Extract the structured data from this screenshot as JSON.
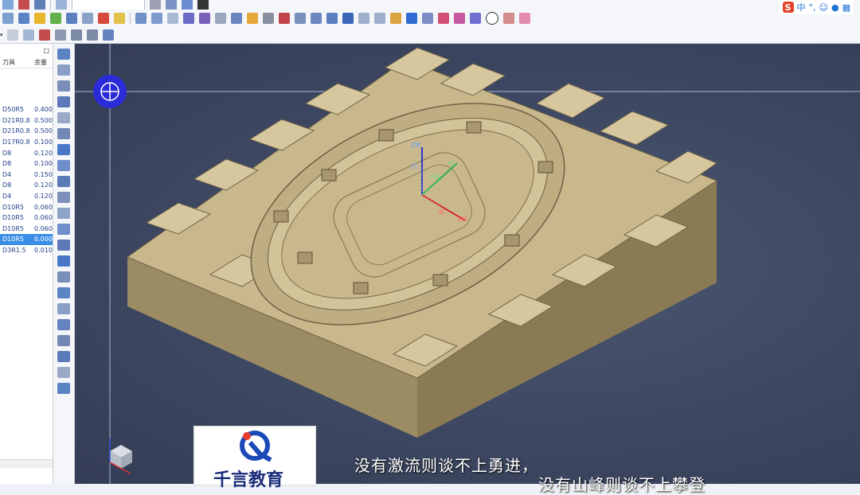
{
  "ime": {
    "logo": "S",
    "lang": "中",
    "punct": "°,"
  },
  "navigator": {
    "columns": [
      "刀具",
      "余量"
    ],
    "tools": [
      {
        "name": "D50R5",
        "allowance": "0.400"
      },
      {
        "name": "D21R0.8",
        "allowance": "0.500"
      },
      {
        "name": "D21R0.8",
        "allowance": "0.500"
      },
      {
        "name": "D17R0.8",
        "allowance": "0.100"
      },
      {
        "name": "D8",
        "allowance": "0.120"
      },
      {
        "name": "D8",
        "allowance": "0.100"
      },
      {
        "name": "D4",
        "allowance": "0.150"
      },
      {
        "name": "D8",
        "allowance": "0.120"
      },
      {
        "name": "D4",
        "allowance": "0.120"
      },
      {
        "name": "D10R5",
        "allowance": "0.060"
      },
      {
        "name": "D10R5",
        "allowance": "0.060"
      },
      {
        "name": "D10R5",
        "allowance": "0.060"
      },
      {
        "name": "D10R5",
        "allowance": "0.000",
        "selected": true
      },
      {
        "name": "D3R1.5",
        "allowance": "0.010"
      }
    ]
  },
  "axes": {
    "zm": "ZM",
    "zc": "ZC",
    "yc": "YC",
    "ym": "YM",
    "xc": "XC",
    "xm": "XM"
  },
  "watermark": {
    "text": "千言教育"
  },
  "subtitles": {
    "line1": "没有激流则谈不上勇进，",
    "line2": "没有山峰则谈不上攀登"
  },
  "colors": {
    "part": "#c9b88c",
    "background": "#3c4660",
    "selection": "#3a8ee6"
  }
}
